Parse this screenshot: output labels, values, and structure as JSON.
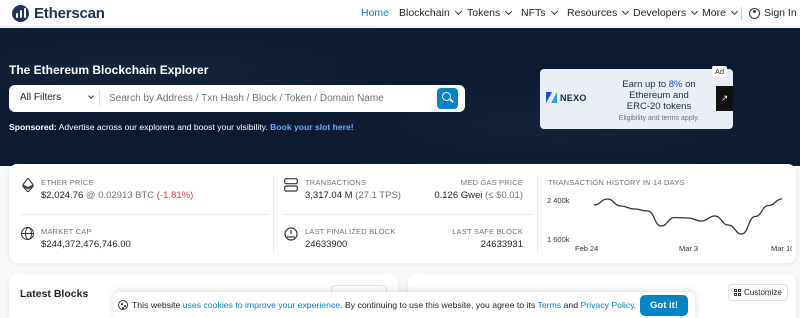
{
  "brand": {
    "name": "Etherscan"
  },
  "nav": {
    "items": [
      {
        "label": "Home",
        "active": true
      },
      {
        "label": "Blockchain"
      },
      {
        "label": "Tokens"
      },
      {
        "label": "NFTs"
      },
      {
        "label": "Resources"
      },
      {
        "label": "Developers"
      },
      {
        "label": "More"
      }
    ],
    "sign_in": "Sign In"
  },
  "hero": {
    "title": "The Ethereum Blockchain Explorer",
    "filter_label": "All Filters",
    "search_placeholder": "Search by Address / Txn Hash / Block / Token / Domain Name",
    "sponsored_label": "Sponsored:",
    "sponsored_text": " Advertise across our explorers and boost your visibility. ",
    "sponsored_link": "Book your slot here!"
  },
  "ad": {
    "tag": "Ad",
    "brand": "NEXO",
    "line1_pre": "Earn up to ",
    "line1_hl": "8%",
    "line1_post": " on",
    "line2": "Ethereum and",
    "line3": "ERC-20 tokens",
    "fine": "Eligibility and terms apply."
  },
  "stats": {
    "ether_price": {
      "label": "ETHER PRICE",
      "usd": "$2,024.76",
      "btc": " @ 0.02913 BTC",
      "change": " (-1.81%)"
    },
    "market_cap": {
      "label": "MARKET CAP",
      "value": "$244,372,476,746.00"
    },
    "transactions": {
      "label": "TRANSACTIONS",
      "value": "3,317.04 M",
      "tps": " (27.1 TPS)"
    },
    "gas": {
      "label": "MED GAS PRICE",
      "value": "0.126 Gwei",
      "usd": " (≤ $0.01)"
    },
    "finalized": {
      "label": "LAST FINALIZED BLOCK",
      "value": "24633900"
    },
    "safe": {
      "label": "LAST SAFE BLOCK",
      "value": "24633931"
    },
    "history_title": "TRANSACTION HISTORY IN 14 DAYS"
  },
  "chart_data": {
    "type": "line",
    "title": "TRANSACTION HISTORY IN 14 DAYS",
    "x": [
      "Feb 24",
      "Feb 25",
      "Feb 26",
      "Feb 27",
      "Feb 28",
      "Mar 1",
      "Mar 2",
      "Mar 3",
      "Mar 4",
      "Mar 5",
      "Mar 6",
      "Mar 7",
      "Mar 8",
      "Mar 9",
      "Mar 10"
    ],
    "series": [
      {
        "values": [
          2300000,
          2420000,
          2280000,
          2220000,
          2180000,
          1880000,
          2050000,
          2040000,
          1980000,
          2080000,
          1900000,
          1720000,
          2070000,
          2290000,
          2420000
        ]
      }
    ],
    "xticks": [
      "Feb 24",
      "Mar 3",
      "Mar 10"
    ],
    "yticks": [
      "2 400k",
      "1 600k"
    ],
    "ylim": [
      1600000,
      2400000
    ],
    "grid": false,
    "line_color": "#333333"
  },
  "latest": {
    "blocks_title": "Latest Blocks",
    "customize": "Customize"
  },
  "cookie": {
    "pre": "This website ",
    "link1": "uses cookies to improve your experience",
    "mid": ". By continuing to use this website, you agree to its ",
    "link2": "Terms",
    "and": " and ",
    "link3": "Privacy Policy",
    "end": ".",
    "button": "Got it!"
  },
  "colors": {
    "accent": "#0784c3",
    "hero_bg": "#0b1a31",
    "negative": "#dc3545"
  }
}
